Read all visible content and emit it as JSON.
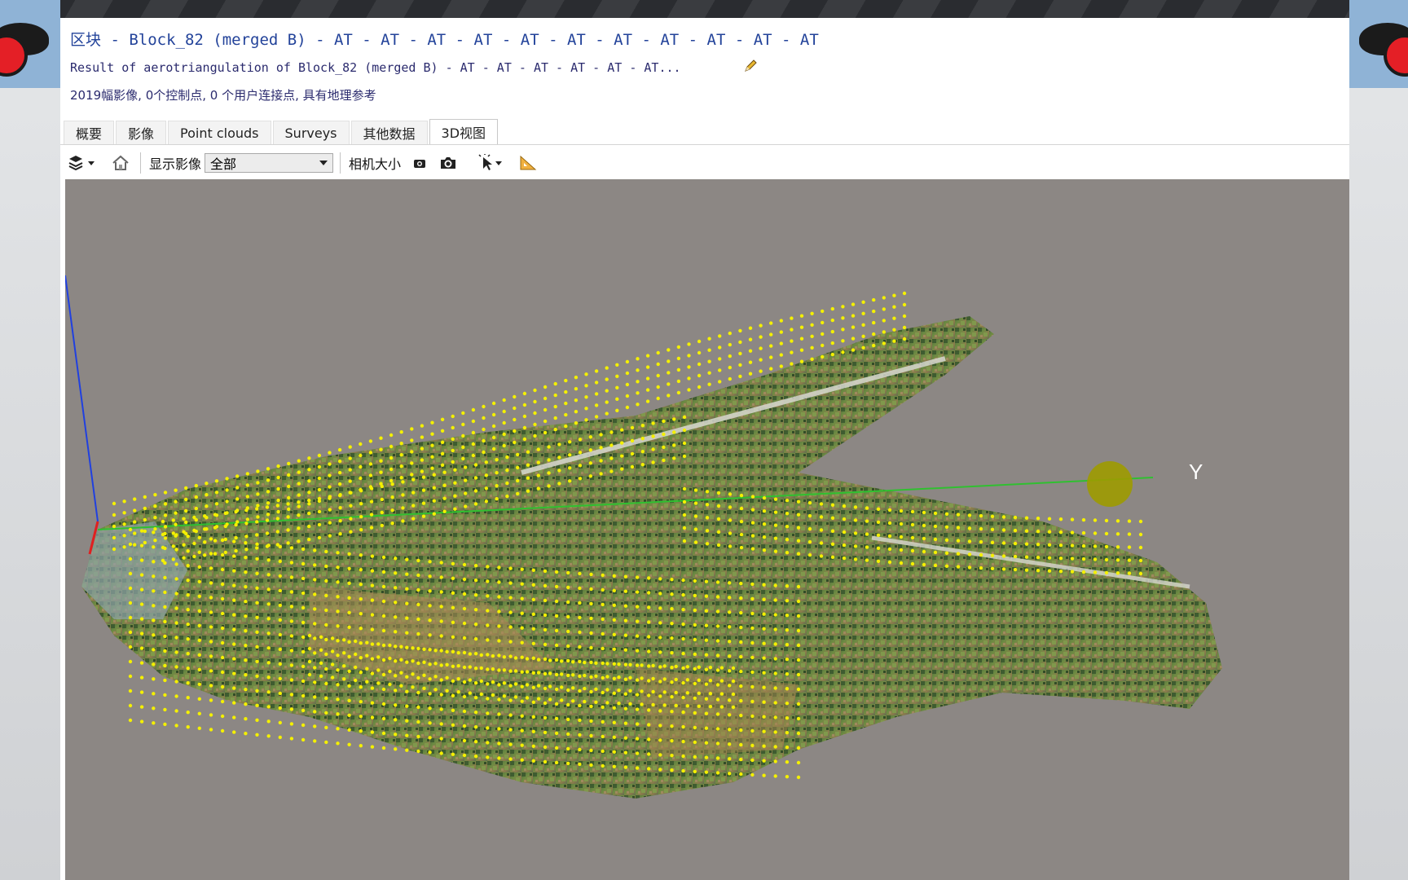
{
  "window": {
    "title": "区块 - Block_82 (merged B) - AT - AT - AT - AT - AT - AT - AT - AT - AT - AT - AT",
    "subtitle": "Result of aerotriangulation of Block_82 (merged B) - AT - AT - AT - AT - AT - AT...",
    "info": "2019幅影像, 0个控制点, 0 个用户连接点, 具有地理参考"
  },
  "tabs": [
    {
      "label": "概要"
    },
    {
      "label": "影像"
    },
    {
      "label": "Point clouds"
    },
    {
      "label": "Surveys"
    },
    {
      "label": "其他数据"
    },
    {
      "label": "3D视图"
    }
  ],
  "active_tab": "3D视图",
  "toolbar": {
    "display_label": "显示影像",
    "display_value": "全部",
    "camera_size_label": "相机大小"
  },
  "viewport": {
    "axis_y_label": "Y",
    "background_color": "#8c8784",
    "camera_point_color": "#f4f000",
    "axis_colors": {
      "x": "#e02020",
      "y": "#30c030",
      "z": "#2040e0"
    }
  },
  "icons": [
    "layers-icon",
    "home-icon",
    "small-camera-icon",
    "camera-icon",
    "cursor-pick-icon",
    "ruler-icon",
    "pencil-edit-icon"
  ]
}
